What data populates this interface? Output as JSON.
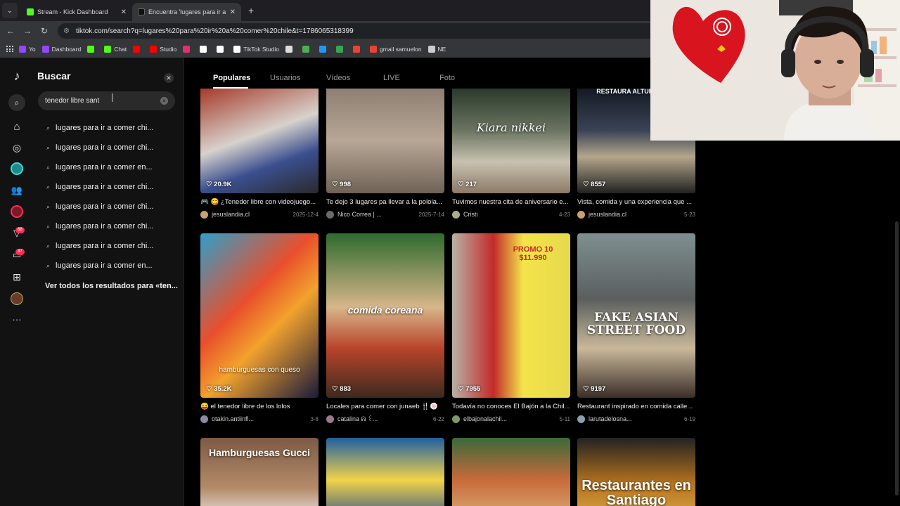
{
  "browser": {
    "tabs": [
      {
        "title": "Stream - Kick Dashboard",
        "favicon_color": "#53fc18"
      },
      {
        "title": "Encuentra 'lugares para ir a com",
        "favicon_color": "#ffffff"
      }
    ],
    "url": "tiktok.com/search?q=lugares%20para%20ir%20a%20comer%20chile&t=1786065318399",
    "bookmarks": [
      {
        "label": "Yo",
        "color": "#9146ff"
      },
      {
        "label": "Dashboard",
        "color": "#9146ff"
      },
      {
        "label": "",
        "color": "#53fc18"
      },
      {
        "label": "Chat",
        "color": "#53fc18"
      },
      {
        "label": "",
        "color": "#ff0000"
      },
      {
        "label": "Studio",
        "color": "#ff0000"
      },
      {
        "label": "",
        "color": "#e1306c"
      },
      {
        "label": "",
        "color": "#ffffff"
      },
      {
        "label": "",
        "color": "#ffffff"
      },
      {
        "label": "TikTok Studio",
        "color": "#ffffff"
      },
      {
        "label": "",
        "color": "#dddddd"
      },
      {
        "label": "",
        "color": "#4caf50"
      },
      {
        "label": "",
        "color": "#2196f3"
      },
      {
        "label": "",
        "color": "#34a853"
      },
      {
        "label": "",
        "color": "#ea4335"
      },
      {
        "label": "gmail samuelon",
        "color": "#ea4335"
      },
      {
        "label": "NE",
        "color": "#cccccc"
      }
    ]
  },
  "sidebar": {
    "title": "Buscar",
    "search_value": "tenedor libre sant",
    "badges": {
      "inbox": "68",
      "messages": "37"
    },
    "suggestions": [
      "lugares para ir a comer chi...",
      "lugares para ir a comer chi...",
      "lugares para ir a comer en...",
      "lugares para ir a comer chi...",
      "lugares para ir a comer chi...",
      "lugares para ir a comer chi...",
      "lugares para ir a comer chi...",
      "lugares para ir a comer en..."
    ],
    "see_all": "Ver todos los resultados para «ten..."
  },
  "content_tabs": [
    "Populares",
    "Usuarios",
    "Vídeos",
    "LIVE",
    "Foto"
  ],
  "videos": [
    {
      "likes": "20.9K",
      "caption": "🎮 😋 ¿Tenedor libre con videojuego...",
      "author": "jesuslandia.cl",
      "date": "2025-12-4",
      "overlay": ""
    },
    {
      "likes": "998",
      "caption": "Te dejo 3 lugares pa llevar a la polola...",
      "author": "Nico Correa | ...",
      "date": "2025-7-14",
      "overlay": ""
    },
    {
      "likes": "217",
      "caption": "Tuvimos nuestra cita de aniversario e...",
      "author": "Cristi",
      "date": "4-23",
      "overlay": "Kiara nikkei"
    },
    {
      "likes": "8557",
      "caption": "Vista, comida y una experiencia que ...",
      "author": "jesuslandia.cl",
      "date": "5-23",
      "overlay": "RESTAURA ALTURAS DE SA"
    },
    {
      "likes": "35.2K",
      "caption": "😝 el tenedor libre de los lolos",
      "author": "otakin.antiinfl...",
      "date": "3-8",
      "overlay": "hamburguesas con queso"
    },
    {
      "likes": "883",
      "caption": "Locales para comer con junaeb 🍴🍥",
      "author": "catalina ᕱ ꒰...",
      "date": "6-22",
      "overlay": "comida coreana"
    },
    {
      "likes": "7955",
      "caption": "Todavía no conoces El Bajón a la Chil...",
      "author": "elbajonalachil...",
      "date": "5-11",
      "overlay": "PROMO 10 $11.990"
    },
    {
      "likes": "9197",
      "caption": "Restaurant inspirado en comida calle...",
      "author": "larutadelosna...",
      "date": "6-19",
      "overlay": "FAKE ASIAN STREET FOOD"
    },
    {
      "likes": "",
      "caption": "",
      "author": "",
      "date": "",
      "overlay": "Hamburguesas Gucci"
    },
    {
      "likes": "",
      "caption": "",
      "author": "",
      "date": "",
      "overlay": ""
    },
    {
      "likes": "",
      "caption": "",
      "author": "",
      "date": "",
      "overlay": ""
    },
    {
      "likes": "",
      "caption": "",
      "author": "",
      "date": "",
      "overlay": "Restaurantes en Santiago"
    }
  ]
}
